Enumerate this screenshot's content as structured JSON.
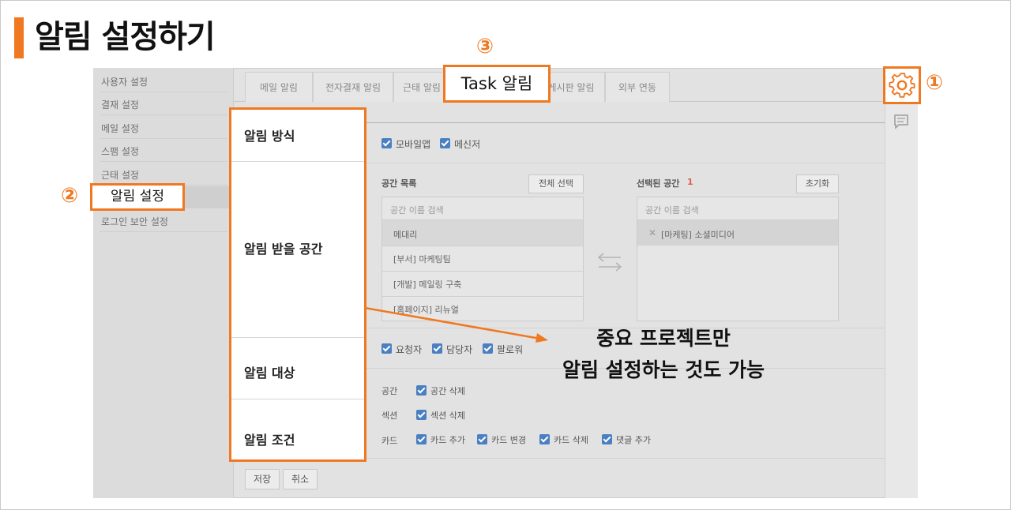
{
  "heading": {
    "title": "알림 설정하기"
  },
  "sidebar": {
    "items": [
      "사용자 설정",
      "결재 설정",
      "메일 설정",
      "스팸 설정",
      "근태 설정",
      "알림 설정",
      "로그인 보안 설정"
    ]
  },
  "tabs": [
    "메일 알림",
    "전자결재 알림",
    "근태 알림",
    "Task 알림",
    "게시판 알림",
    "외부 연동"
  ],
  "callouts": {
    "num1": "①",
    "num2": "②",
    "num3": "③",
    "task_tab_label": "Task 알림",
    "menu_label": "알림 설정"
  },
  "panel": {
    "method": "알림 방식",
    "spaces": "알림 받을 공간",
    "targets": "알림 대상",
    "conditions": "알림 조건"
  },
  "method_options": [
    "모바일앱",
    "메신저"
  ],
  "space_list": {
    "title": "공간 목록",
    "select_all": "전체 선택",
    "search_placeholder": "공간 이름 검색",
    "items": [
      "메대리",
      "[부서] 마케팅팀",
      "[개발] 메일링 구축",
      "[홈페이지] 리뉴얼"
    ]
  },
  "selected_list": {
    "title": "선택된 공간",
    "count": "1",
    "reset": "초기화",
    "search_placeholder": "공간 이름 검색",
    "items": [
      "[마케팅] 소셜미디어"
    ]
  },
  "target_options": [
    "요청자",
    "담당자",
    "팔로워"
  ],
  "conditions": {
    "space_label": "공간",
    "space_options": [
      "공간 삭제"
    ],
    "section_label": "섹션",
    "section_options": [
      "섹션 삭제"
    ],
    "card_label": "카드",
    "card_options": [
      "카드 추가",
      "카드 변경",
      "카드 삭제",
      "댓글 추가"
    ]
  },
  "footer": {
    "save": "저장",
    "cancel": "취소"
  },
  "annotation": {
    "line1": "중요 프로젝트만",
    "line2": "알림 설정하는 것도 가능"
  },
  "colors": {
    "accent": "#f07820",
    "checkbox": "#4a7fc1",
    "count": "#e06040"
  }
}
